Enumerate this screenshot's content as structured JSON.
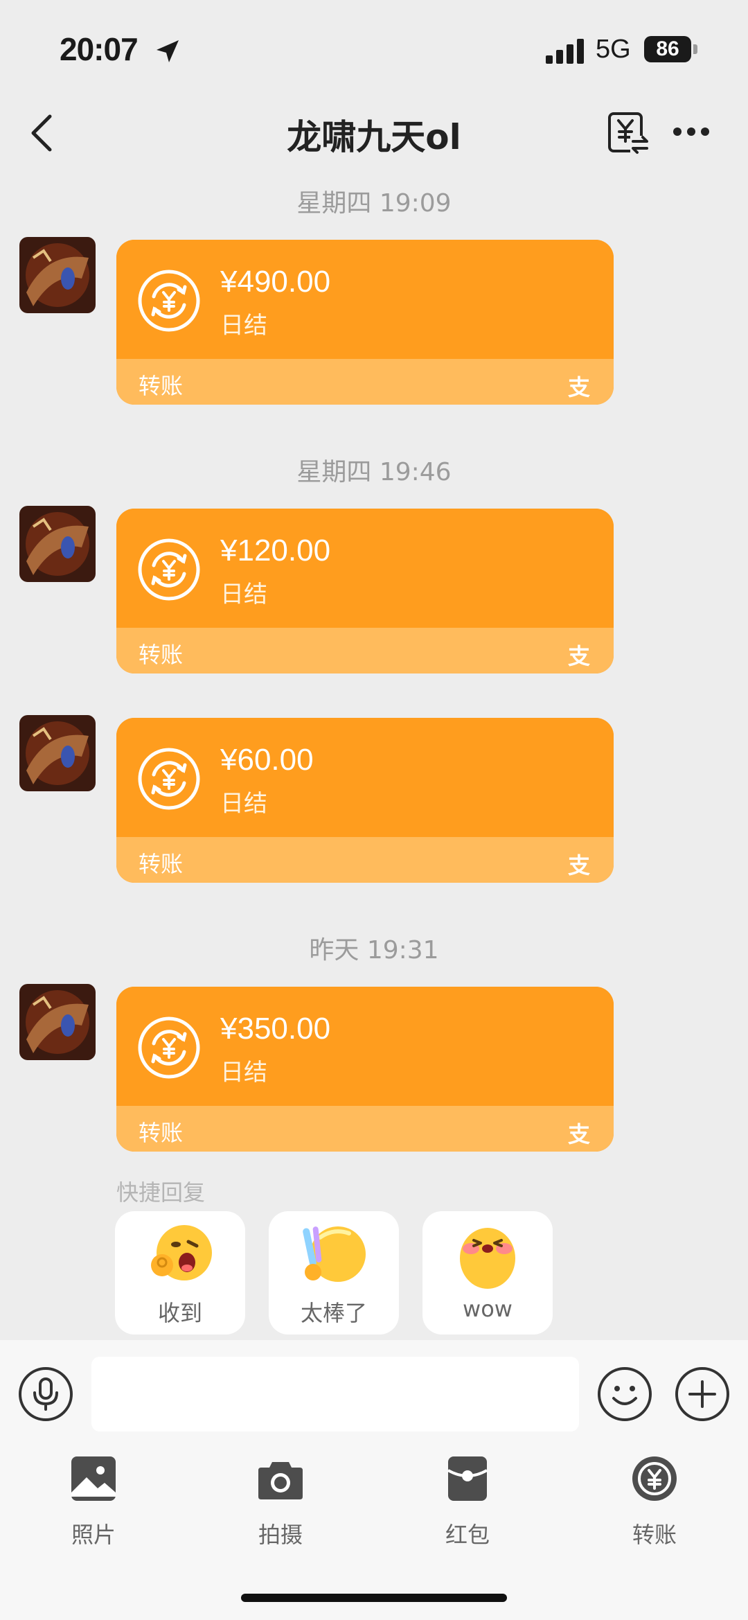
{
  "status_bar": {
    "time": "20:07",
    "network": "5G",
    "battery": "86"
  },
  "header": {
    "title": "龙啸九天ol"
  },
  "messages": [
    {
      "timestamp": "星期四 19:09",
      "amount": "¥490.00",
      "note": "日结",
      "label": "转账",
      "brand": "支"
    },
    {
      "timestamp": "星期四 19:46",
      "amount": "¥120.00",
      "note": "日结",
      "label": "转账",
      "brand": "支"
    },
    {
      "timestamp": "",
      "amount": "¥60.00",
      "note": "日结",
      "label": "转账",
      "brand": "支"
    },
    {
      "timestamp": "昨天 19:31",
      "amount": "¥350.00",
      "note": "日结",
      "label": "转账",
      "brand": "支"
    }
  ],
  "quick_reply": {
    "label": "快捷回复",
    "items": [
      {
        "text": "收到",
        "icon": "ok-hand-emoji"
      },
      {
        "text": "太棒了",
        "icon": "thumbs-up-emoji"
      },
      {
        "text": "wow",
        "icon": "blush-emoji"
      }
    ]
  },
  "input": {
    "placeholder": ""
  },
  "tools": [
    {
      "label": "照片",
      "icon": "photo-icon"
    },
    {
      "label": "拍摄",
      "icon": "camera-icon"
    },
    {
      "label": "红包",
      "icon": "red-packet-icon"
    },
    {
      "label": "转账",
      "icon": "transfer-icon"
    }
  ],
  "colors": {
    "card": "#FF9D1E",
    "card_footer": "#FFBB5C",
    "background": "#EDEDED"
  }
}
